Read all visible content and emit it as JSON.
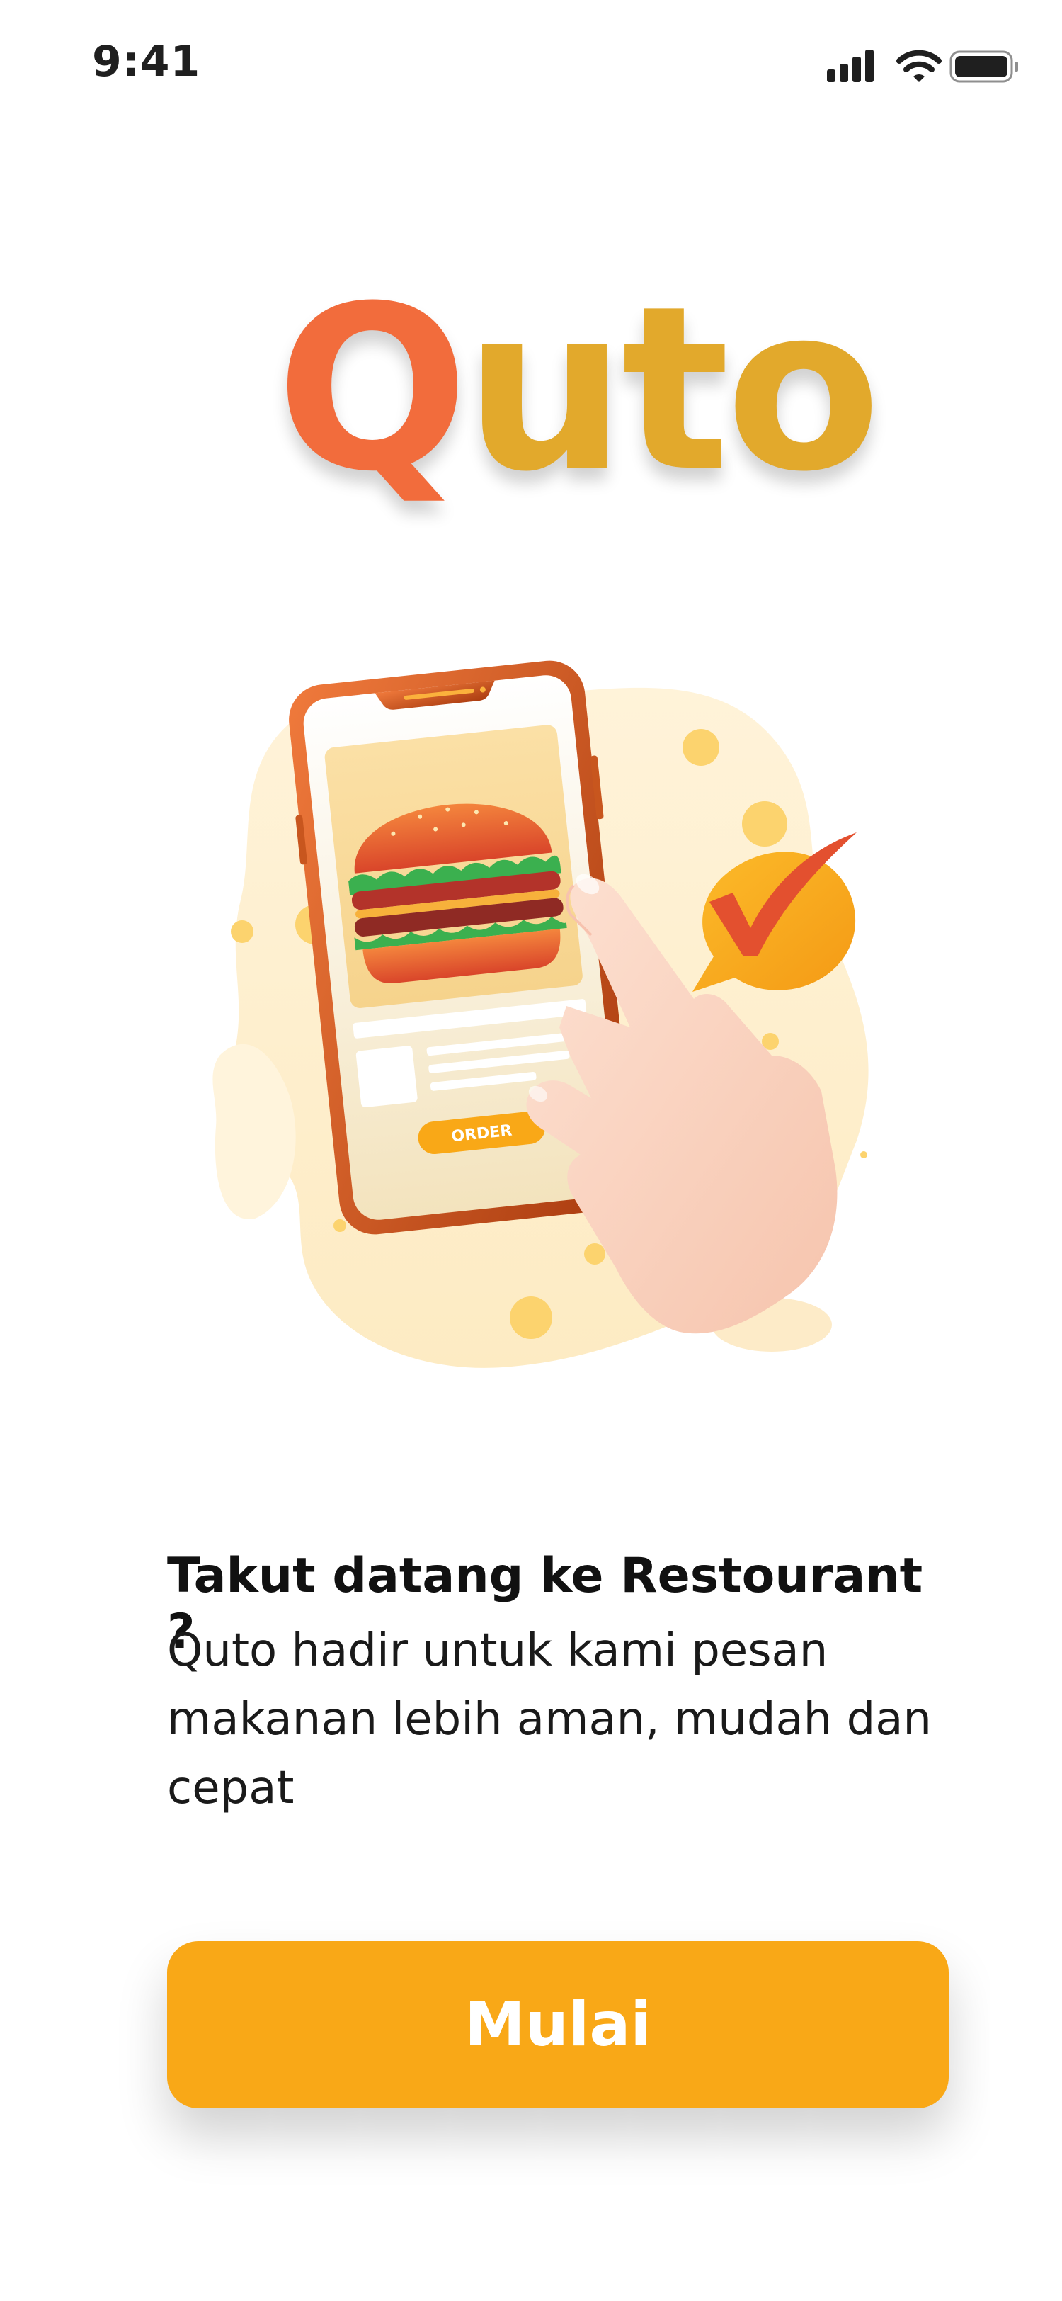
{
  "status_bar": {
    "time": "9:41",
    "icons": [
      "cellular-signal-icon",
      "wifi-icon",
      "battery-icon"
    ]
  },
  "logo": {
    "first_letter": "Q",
    "rest": "uto",
    "colors": {
      "first_letter": "#f26c3c",
      "rest": "#e2a92c"
    }
  },
  "illustration": {
    "order_button_label": "ORDER",
    "icons": [
      "phone-illustration",
      "burger-icon",
      "hand-pointer-icon",
      "checkmark-bubble-icon"
    ]
  },
  "intro": {
    "headline": "Takut datang ke Restourant ?",
    "body": "Quto hadir untuk kami pesan makanan lebih aman, mudah dan cepat"
  },
  "cta": {
    "label": "Mulai",
    "color": "#f9a817"
  }
}
